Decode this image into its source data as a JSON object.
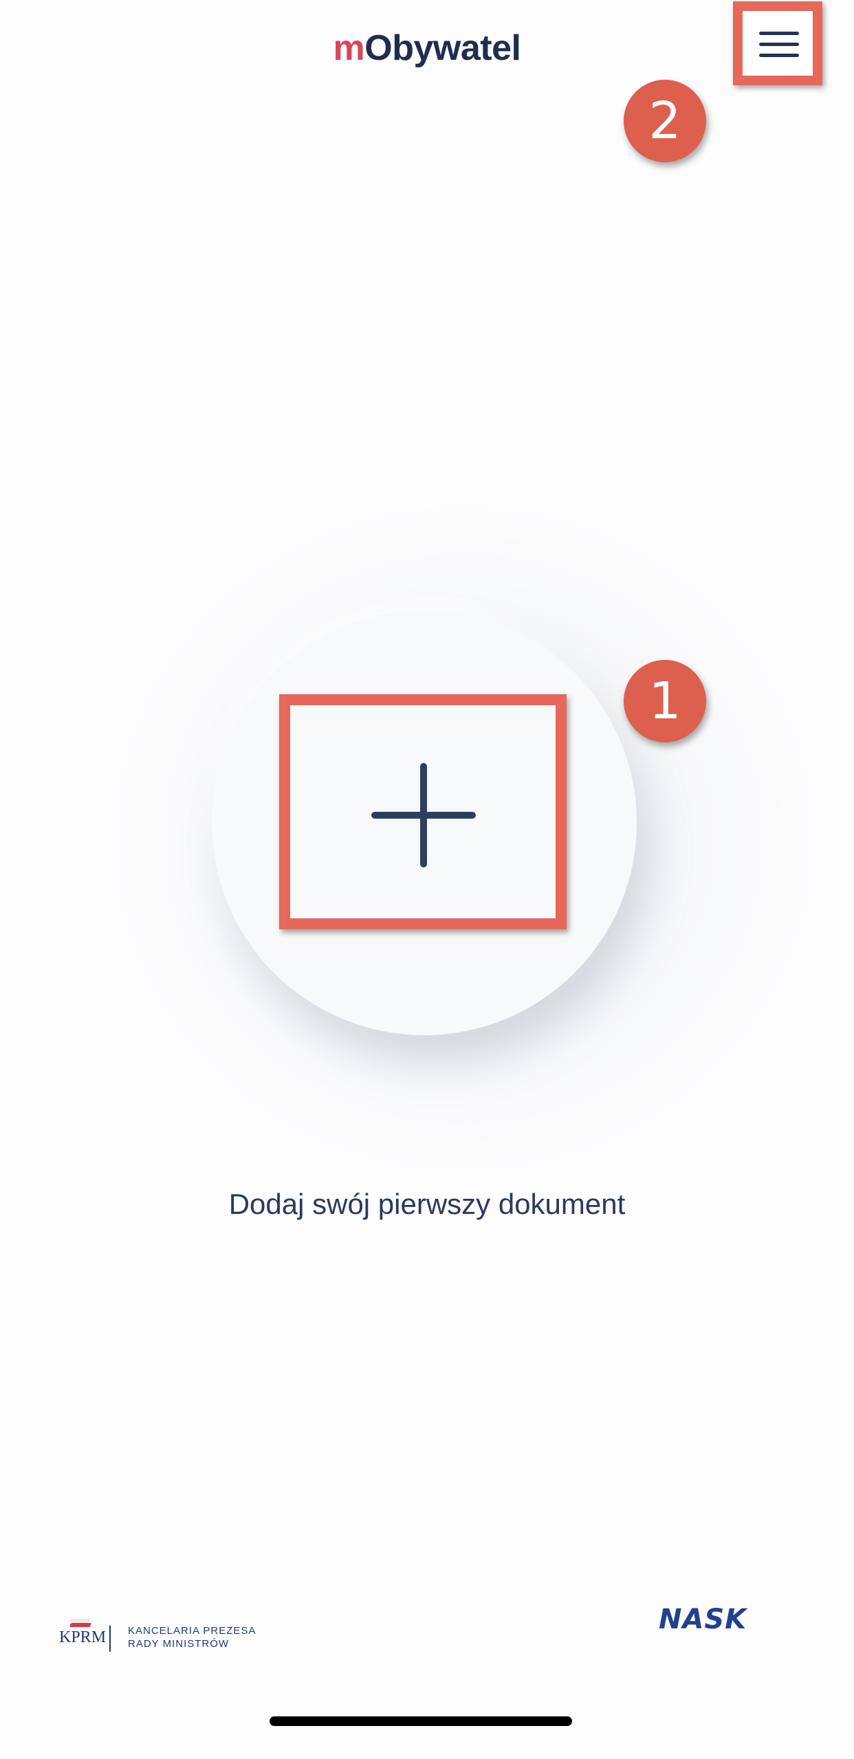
{
  "header": {
    "title_prefix": "m",
    "title_rest": "Obywatel",
    "menu_icon": "hamburger-menu-icon"
  },
  "annotations": {
    "step_1": "1",
    "step_2": "2"
  },
  "main": {
    "add_icon": "plus-icon",
    "cta_text": "Dodaj swój pierwszy dokument"
  },
  "footer": {
    "kprm_abbr": "KPRM",
    "kprm_line1": "KANCELARIA PREZESA",
    "kprm_line2": "RADY MINISTRÓW",
    "nask": "NASK"
  },
  "colors": {
    "brand_red": "#d7475a",
    "navy": "#1f2d4e",
    "highlight": "#e5685a",
    "badge": "#dd5f4e"
  }
}
